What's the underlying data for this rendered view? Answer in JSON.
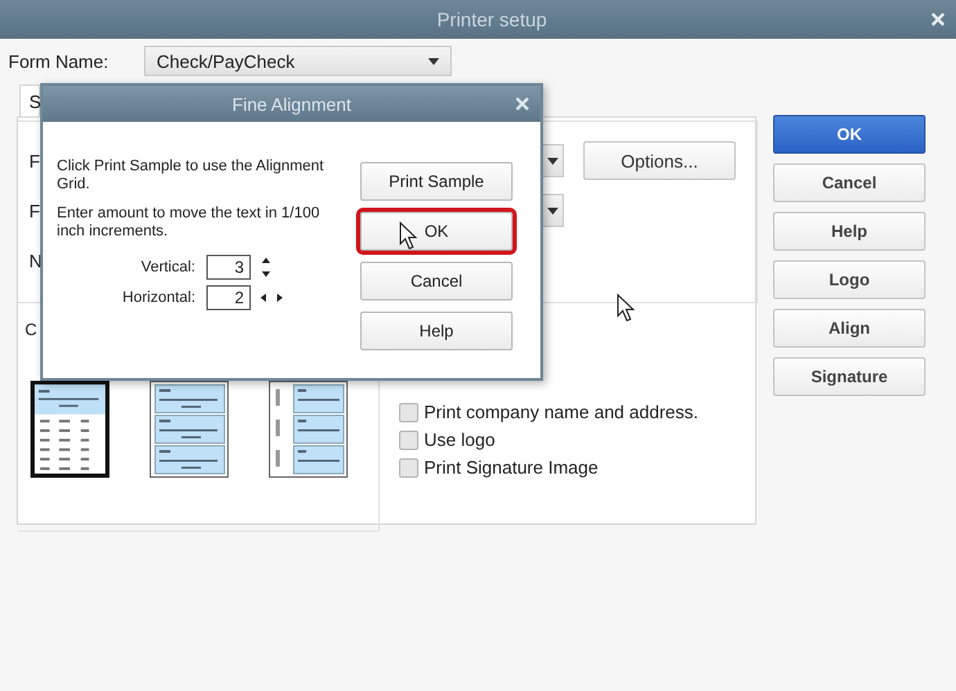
{
  "window": {
    "title": "Printer setup"
  },
  "form_name": {
    "label": "Form Name:",
    "value": "Check/PayCheck"
  },
  "tab": {
    "label": "S",
    "selected": true
  },
  "settings_rows": [
    {
      "label": "F",
      "options_button": "Options..."
    },
    {
      "label": "F"
    },
    {
      "label": "N"
    }
  ],
  "check_style_label": "C",
  "check_styles": [
    {
      "kind": "voucher",
      "selected": true
    },
    {
      "kind": "standard",
      "selected": false
    },
    {
      "kind": "wallet",
      "selected": false
    }
  ],
  "checkboxes": [
    {
      "label": "Print company name and address.",
      "checked": false
    },
    {
      "label": "Use logo",
      "checked": false
    },
    {
      "label": "Print Signature Image",
      "checked": false
    }
  ],
  "buttons": [
    {
      "label": "OK",
      "primary": true
    },
    {
      "label": "Cancel",
      "primary": false
    },
    {
      "label": "Help",
      "primary": false
    },
    {
      "label": "Logo",
      "primary": false
    },
    {
      "label": "Align",
      "primary": false
    },
    {
      "label": "Signature",
      "primary": false
    }
  ],
  "dialog": {
    "title": "Fine Alignment",
    "instructions": [
      "Click Print Sample to use the Alignment Grid.",
      "Enter amount to move the text in 1/100 inch increments."
    ],
    "fields": [
      {
        "kind": "vertical",
        "label": "Vertical:",
        "value": "3"
      },
      {
        "kind": "horizontal",
        "label": "Horizontal:",
        "value": "2"
      }
    ],
    "buttons": [
      {
        "label": "Print Sample",
        "highlighted": false
      },
      {
        "label": "OK",
        "highlighted": true
      },
      {
        "label": "Cancel",
        "highlighted": false
      },
      {
        "label": "Help",
        "highlighted": false
      }
    ]
  }
}
